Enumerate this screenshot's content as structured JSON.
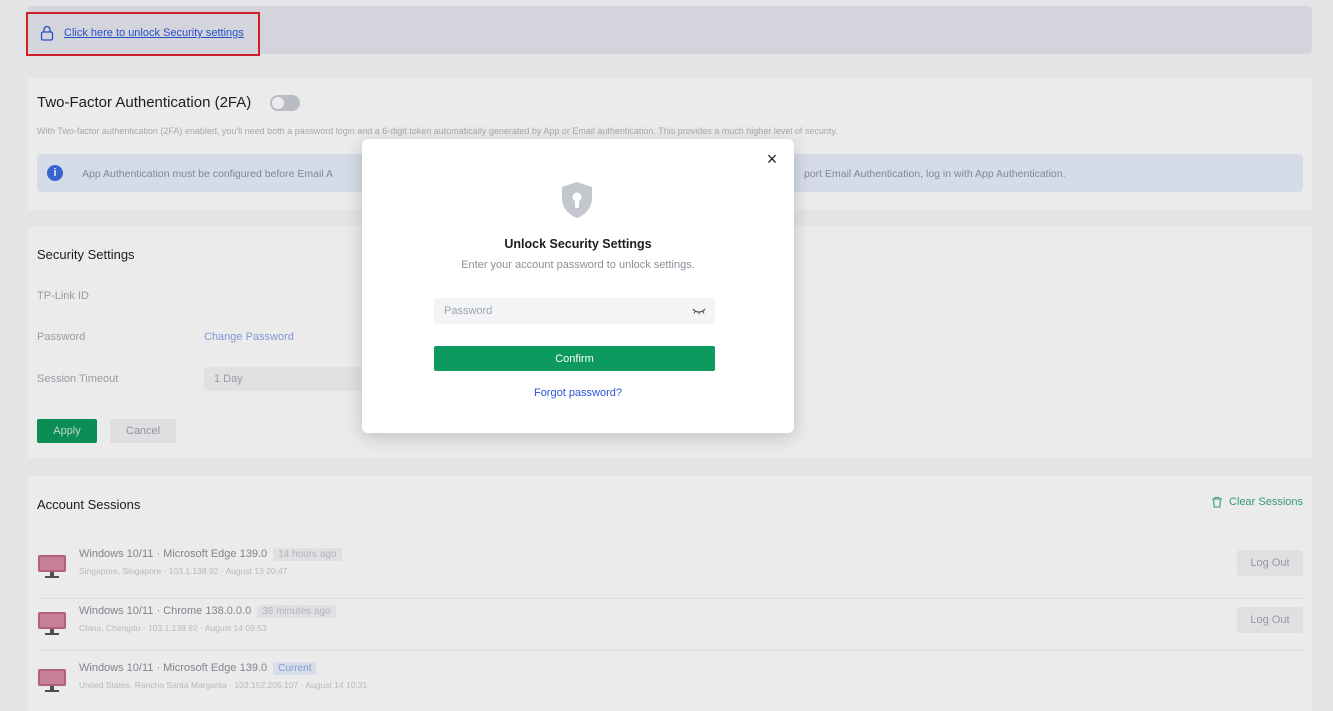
{
  "unlock": {
    "link_text": "Click here to unlock Security settings"
  },
  "twofa": {
    "title": "Two-Factor Authentication (2FA)",
    "enabled": false,
    "description": "With Two-factor authentication (2FA) enabled, you'll need both a password login and a 6-digit token automatically generated by App or Email authentication. This provides a much higher level of security.",
    "info_left": "App Authentication must be configured before Email A",
    "info_right": "port Email Authentication, log in with App Authentication."
  },
  "security_settings": {
    "title": "Security Settings",
    "tplink_id_label": "TP-Link ID",
    "password_label": "Password",
    "change_password_link": "Change Password",
    "session_timeout_label": "Session Timeout",
    "session_timeout_value": "1 Day",
    "apply_label": "Apply",
    "cancel_label": "Cancel"
  },
  "sessions": {
    "title": "Account Sessions",
    "clear_label": "Clear Sessions",
    "items": [
      {
        "device": "Windows 10/11 · Microsoft Edge 139.0",
        "tag": "14 hours ago",
        "meta": "Singapore, Singapore · 103.1.138.92 · August 13 20:47",
        "action": "Log Out"
      },
      {
        "device": "Windows 10/11 · Chrome 138.0.0.0",
        "tag": "38 minutes ago",
        "meta": "China, Chengdu · 103.1.138.92 · August 14 09:53",
        "action": "Log Out"
      },
      {
        "device": "Windows 10/11 · Microsoft Edge 139.0",
        "tag": "Current",
        "meta": "United States, Rancho Santa Margarita · 103.152.205.107 · August 14 10:31",
        "action": ""
      }
    ]
  },
  "modal": {
    "title": "Unlock Security Settings",
    "subtitle": "Enter your account password to unlock settings.",
    "password_placeholder": "Password",
    "confirm_label": "Confirm",
    "forgot_label": "Forgot password?",
    "close_glyph": "×"
  },
  "colors": {
    "accent_green": "#0d9a5e",
    "link_blue": "#2a55d8",
    "highlight_red": "#e0232b"
  },
  "icons": {
    "lock": "lock-icon",
    "info": "info-icon",
    "shield": "shield-lock-icon",
    "eye": "eye-closed-icon",
    "trash": "trash-icon",
    "monitor": "monitor-icon"
  }
}
